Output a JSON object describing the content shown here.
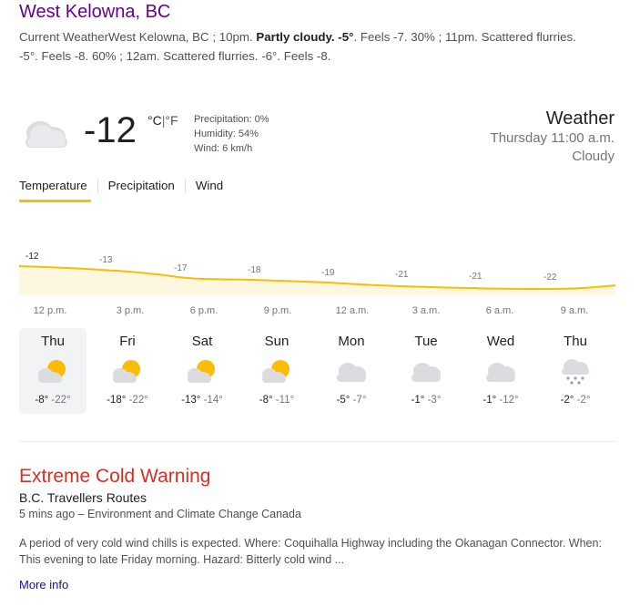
{
  "result": {
    "title": "West Kelowna, BC",
    "snippet_1": "Current WeatherWest Kelowna, BC ; 10pm. ",
    "snippet_bold": "Partly cloudy. -5°",
    "snippet_2": ". Feels -7. 30% ; 11pm. Scattered flurries. -5°. Feels -8. 60% ; 12am. Scattered flurries. -6°. Feels -8."
  },
  "weather": {
    "temp": "-12",
    "unit_c": "°C",
    "unit_sep": "|",
    "unit_f": "°F",
    "precipitation": "Precipitation: 0%",
    "humidity": "Humidity: 54%",
    "wind": "Wind: 6 km/h",
    "label": "Weather",
    "time": "Thursday 11:00 a.m.",
    "condition": "Cloudy"
  },
  "tabs": [
    "Temperature",
    "Precipitation",
    "Wind"
  ],
  "hourly": {
    "temps": [
      "-12",
      "-13",
      "-17",
      "-18",
      "-19",
      "-21",
      "-21",
      "-22"
    ],
    "hours": [
      "12 p.m.",
      "3 p.m.",
      "6 p.m.",
      "9 p.m.",
      "12 a.m.",
      "3 a.m.",
      "6 a.m.",
      "9 a.m."
    ],
    "line_color": "#fbbc04"
  },
  "days": [
    {
      "name": "Thu",
      "hi": "-8°",
      "lo": "-22°",
      "icon": "partly-cloudy-icon"
    },
    {
      "name": "Fri",
      "hi": "-18°",
      "lo": "-22°",
      "icon": "partly-cloudy-icon"
    },
    {
      "name": "Sat",
      "hi": "-13°",
      "lo": "-14°",
      "icon": "partly-cloudy-icon"
    },
    {
      "name": "Sun",
      "hi": "-8°",
      "lo": "-11°",
      "icon": "partly-cloudy-icon"
    },
    {
      "name": "Mon",
      "hi": "-5°",
      "lo": "-7°",
      "icon": "cloudy-icon"
    },
    {
      "name": "Tue",
      "hi": "-1°",
      "lo": "-3°",
      "icon": "cloudy-icon"
    },
    {
      "name": "Wed",
      "hi": "-1°",
      "lo": "-12°",
      "icon": "cloudy-icon"
    },
    {
      "name": "Thu",
      "hi": "-2°",
      "lo": "-2°",
      "icon": "snow-icon"
    }
  ],
  "alert": {
    "title": "Extreme Cold Warning",
    "source": "B.C. Travellers Routes",
    "meta": "5 mins ago – Environment and Climate Change Canada",
    "body": "A period of very cold wind chills is expected. Where: Coquihalla Highway including the Okanagan Connector. When: This evening to late Friday morning. Hazard: Bitterly cold wind ...",
    "more_info": "More info"
  }
}
